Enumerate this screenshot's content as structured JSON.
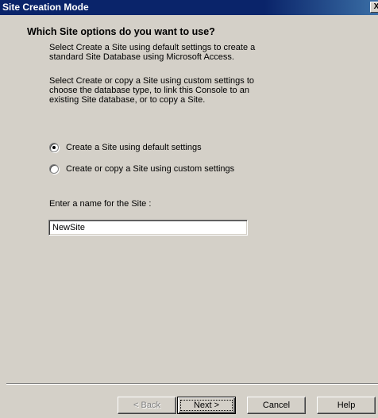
{
  "window": {
    "title": "Site Creation Mode",
    "close_glyph": "X"
  },
  "content": {
    "heading": "Which Site options do you want to use?",
    "paragraph1": "Select Create a Site using default settings to create a standard Site Database using Microsoft Access.",
    "paragraph2": "Select Create or copy a Site using custom settings to choose the database type, to link this Console to an existing Site database, or to copy a Site.",
    "options": [
      {
        "label": "Create a Site using default settings",
        "selected": true
      },
      {
        "label": "Create or copy a Site using custom settings",
        "selected": false
      }
    ],
    "name_label": "Enter a name for the Site :",
    "name_value": "NewSite"
  },
  "buttons": {
    "back": "< Back",
    "next": "Next >",
    "cancel": "Cancel",
    "help": "Help"
  }
}
